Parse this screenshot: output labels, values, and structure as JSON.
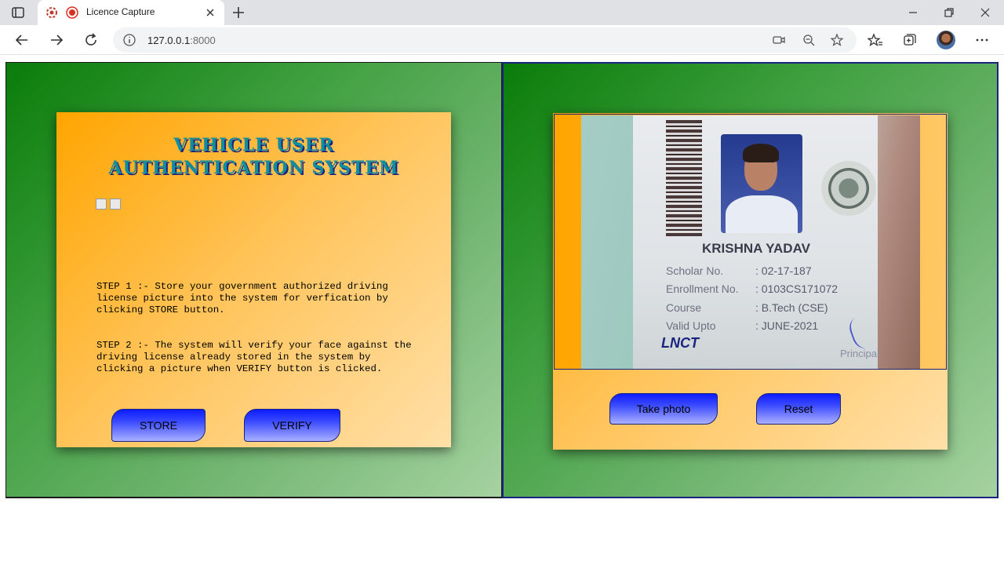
{
  "browser": {
    "tab_title": "Licence Capture",
    "url_host": "127.0.0.1",
    "url_port": ":8000"
  },
  "app": {
    "title": "VEHICLE USER AUTHENTICATION SYSTEM",
    "step1": "STEP 1 :- Store your government authorized driving license picture into the system for verfication by clicking STORE button.",
    "step2": "STEP 2 :- The system will verify your face against the driving license already stored in the system by clicking a picture when VERIFY button is clicked.",
    "store_label": "STORE",
    "verify_label": "VERIFY"
  },
  "camera": {
    "take_photo_label": "Take photo",
    "reset_label": "Reset",
    "id_card": {
      "name": "KRISHNA YADAV",
      "rows": [
        {
          "label": "Scholar No.",
          "value": ": 02-17-187"
        },
        {
          "label": "Enrollment No.",
          "value": ": 0103CS171072"
        },
        {
          "label": "Course",
          "value": ": B.Tech (CSE)"
        },
        {
          "label": "Valid Upto",
          "value": ": JUNE-2021"
        }
      ],
      "logo": "LNCT",
      "signature_caption": "Principal"
    }
  },
  "colors": {
    "panel_green": "#0a7c0a",
    "card_orange": "#ffa500",
    "button_blue": "#0d1cff",
    "title_teal": "#108ea0"
  }
}
